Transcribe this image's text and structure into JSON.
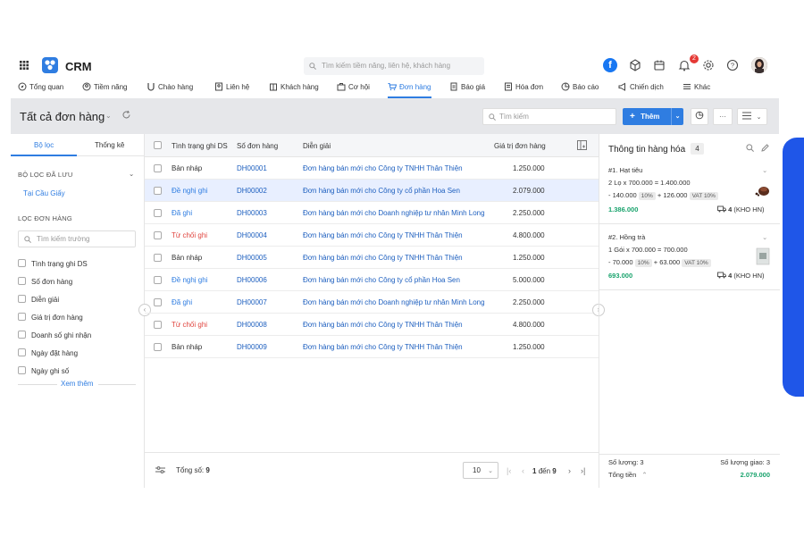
{
  "app": {
    "name": "CRM"
  },
  "topbar": {
    "search_placeholder": "Tìm kiếm tiềm năng, liên hệ, khách hàng",
    "notification_count": "2"
  },
  "nav": [
    {
      "label": "Tổng quan",
      "icon": "compass-icon"
    },
    {
      "label": "Tiềm năng",
      "icon": "user-circle-icon"
    },
    {
      "label": "Chào hàng",
      "icon": "magnet-icon"
    },
    {
      "label": "Liên hệ",
      "icon": "contact-icon"
    },
    {
      "label": "Khách hàng",
      "icon": "building-icon"
    },
    {
      "label": "Cơ hội",
      "icon": "briefcase-icon"
    },
    {
      "label": "Đơn hàng",
      "icon": "cart-icon"
    },
    {
      "label": "Báo giá",
      "icon": "quote-icon"
    },
    {
      "label": "Hóa đơn",
      "icon": "invoice-icon"
    },
    {
      "label": "Báo cáo",
      "icon": "pie-chart-icon"
    },
    {
      "label": "Chiến dịch",
      "icon": "megaphone-icon"
    },
    {
      "label": "Khác",
      "icon": "menu-icon"
    }
  ],
  "header": {
    "title": "Tất cả đơn hàng",
    "search_placeholder": "Tìm kiếm",
    "add_label": "Thêm"
  },
  "filters": {
    "tab_filter": "Bộ lọc",
    "tab_stats": "Thống kê",
    "saved_heading": "BỘ LỌC ĐÃ LƯU",
    "saved_item": "Tại Cầu Giấy",
    "order_heading": "LỌC ĐƠN HÀNG",
    "field_search_placeholder": "Tìm kiếm trường",
    "fields": [
      "Tình trạng ghi DS",
      "Số đơn hàng",
      "Diễn giải",
      "Giá trị đơn hàng",
      "Doanh số ghi nhận",
      "Ngày đặt hàng",
      "Ngày ghi số"
    ],
    "more": "Xem thêm"
  },
  "table": {
    "columns": [
      "Tình trạng ghi DS",
      "Số đơn hàng",
      "Diễn giải",
      "Giá trị đơn hàng"
    ],
    "rows": [
      {
        "status": "Bản nháp",
        "status_type": "draft",
        "code": "DH00001",
        "desc": "Đơn hàng bán mới cho Công ty TNHH Thân Thiện",
        "value": "1.250.000"
      },
      {
        "status": "Đề nghị ghi",
        "status_type": "propose",
        "code": "DH00002",
        "desc": "Đơn hàng bán mới cho Công ty cổ phần Hoa Sen",
        "value": "2.079.000"
      },
      {
        "status": "Đã ghi",
        "status_type": "recorded",
        "code": "DH00003",
        "desc": "Đơn hàng bán mới cho Doanh nghiệp tư nhân Minh Long",
        "value": "2.250.000"
      },
      {
        "status": "Từ chối ghi",
        "status_type": "rejected",
        "code": "DH00004",
        "desc": "Đơn hàng bán mới cho Công ty TNHH Thân Thiện",
        "value": "4.800.000"
      },
      {
        "status": "Bản nháp",
        "status_type": "draft",
        "code": "DH00005",
        "desc": "Đơn hàng bán mới cho Công ty TNHH Thân Thiện",
        "value": "1.250.000"
      },
      {
        "status": "Đề nghị ghi",
        "status_type": "propose",
        "code": "DH00006",
        "desc": "Đơn hàng bán mới cho Công ty cổ phần Hoa Sen",
        "value": "5.000.000"
      },
      {
        "status": "Đã ghi",
        "status_type": "recorded",
        "code": "DH00007",
        "desc": "Đơn hàng bán mới cho Doanh nghiệp tư nhân Minh Long",
        "value": "2.250.000"
      },
      {
        "status": "Từ chối ghi",
        "status_type": "rejected",
        "code": "DH00008",
        "desc": "Đơn hàng bán mới cho Công ty TNHH Thân Thiện",
        "value": "4.800.000"
      },
      {
        "status": "Bản nháp",
        "status_type": "draft",
        "code": "DH00009",
        "desc": "Đơn hàng bán mới cho Công ty TNHH Thân Thiện",
        "value": "1.250.000"
      }
    ],
    "selected_row": 1
  },
  "footer": {
    "total_label": "Tổng số:",
    "total_value": "9",
    "page_size": "10",
    "range_start": "1",
    "range_sep": "đến",
    "range_end": "9"
  },
  "detail": {
    "title": "Thông tin hàng hóa",
    "count": "4",
    "products": [
      {
        "name": "#1. Hạt tiêu",
        "calc": "2 Lọ x 700.000 = 1.400.000",
        "discount": "- 140.000",
        "discount_pct": "10%",
        "vat": "+ 126.000",
        "vat_label": "VAT 10%",
        "total": "1.386.000",
        "qty": "4",
        "warehouse": "(KHO HN)"
      },
      {
        "name": "#2. Hồng trà",
        "calc": "1 Gói x 700.000 = 700.000",
        "discount": "- 70.000",
        "discount_pct": "10%",
        "vat": "+ 63.000",
        "vat_label": "VAT 10%",
        "total": "693.000",
        "qty": "4",
        "warehouse": "(KHO HN)"
      }
    ],
    "summary": {
      "qty_label": "Số lượng: 3",
      "delivered_label": "Số lượng giao: 3",
      "total_label": "Tổng tiền",
      "total_value": "2.079.000"
    }
  },
  "colors": {
    "accent": "#2f7de1",
    "rejected": "#e0443e",
    "positive": "#1aa36d",
    "side_bar": "#1f56e8"
  }
}
